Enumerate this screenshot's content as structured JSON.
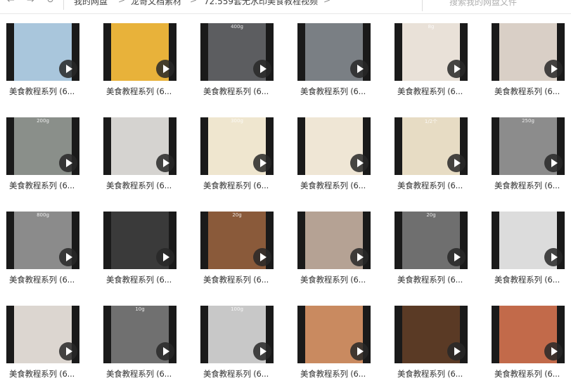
{
  "toolbar": {
    "back_icon": "back-arrow-icon",
    "forward_icon": "forward-arrow-icon",
    "refresh_icon": "refresh-icon"
  },
  "breadcrumb": {
    "items": [
      "我的网盘",
      "龙哥文档素材",
      "72.559套无水印美食教程视频"
    ]
  },
  "search": {
    "placeholder": "搜索我的网盘文件"
  },
  "files": [
    {
      "name": "美食教程系列 (6...",
      "thumb": "tofu",
      "tag": ""
    },
    {
      "name": "美食教程系列 (6...",
      "thumb": "eggs-mushroom",
      "tag": ""
    },
    {
      "name": "美食教程系列 (6...",
      "thumb": "gray-bowl",
      "tag": "400g"
    },
    {
      "name": "美食教程系列 (6...",
      "thumb": "pan",
      "tag": ""
    },
    {
      "name": "美食教程系列 (6...",
      "thumb": "sauce-dish",
      "tag": "8g"
    },
    {
      "name": "美食教程系列 (6...",
      "thumb": "red-meat",
      "tag": ""
    },
    {
      "name": "美食教程系列 (6...",
      "thumb": "seaweed-bowl",
      "tag": "200g"
    },
    {
      "name": "美食教程系列 (6...",
      "thumb": "white-plate",
      "tag": ""
    },
    {
      "name": "美食教程系列 (6...",
      "thumb": "cabbage",
      "tag": "300g"
    },
    {
      "name": "美食教程系列 (6...",
      "thumb": "garlic-bowl",
      "tag": ""
    },
    {
      "name": "美食教程系列 (6...",
      "thumb": "cabbage-half",
      "tag": "1/2个"
    },
    {
      "name": "美食教程系列 (6...",
      "thumb": "gray-surface",
      "tag": "250g"
    },
    {
      "name": "美食教程系列 (6...",
      "thumb": "meat-bowl",
      "tag": "800g"
    },
    {
      "name": "美食教程系列 (6...",
      "thumb": "rice-cooker",
      "tag": ""
    },
    {
      "name": "美食教程系列 (6...",
      "thumb": "wood-glass",
      "tag": "20g"
    },
    {
      "name": "美食教程系列 (6...",
      "thumb": "wood-glass2",
      "tag": ""
    },
    {
      "name": "美食教程系列 (6...",
      "thumb": "gray-glass",
      "tag": "20g"
    },
    {
      "name": "美食教程系列 (6...",
      "thumb": "green-onion",
      "tag": ""
    },
    {
      "name": "美食教程系列 (6...",
      "thumb": "shrimp",
      "tag": ""
    },
    {
      "name": "美食教程系列 (6...",
      "thumb": "gray-glass2",
      "tag": "10g"
    },
    {
      "name": "美食教程系列 (6...",
      "thumb": "gray-glass3",
      "tag": "100g"
    },
    {
      "name": "美食教程系列 (6...",
      "thumb": "hands-dough",
      "tag": ""
    },
    {
      "name": "美食教程系列 (6...",
      "thumb": "fried-chicken",
      "tag": ""
    },
    {
      "name": "美食教程系列 (6...",
      "thumb": "blender",
      "tag": ""
    }
  ],
  "thumb_colors": {
    "tofu": "#a9c6dc",
    "eggs-mushroom": "#e8b23a",
    "gray-bowl": "#5c5d60",
    "pan": "#7a7f84",
    "sauce-dish": "#e9e1d8",
    "red-meat": "#d9cfc6",
    "seaweed-bowl": "#8a8f8a",
    "white-plate": "#d5d3d0",
    "cabbage": "#efe6cf",
    "garlic-bowl": "#efe6d5",
    "cabbage-half": "#e7dcc4",
    "gray-surface": "#8c8c8c",
    "meat-bowl": "#8b8b8b",
    "rice-cooker": "#3a3a3a",
    "wood-glass": "#8a5a3a",
    "wood-glass2": "#b5a294",
    "gray-glass": "#6f6f6f",
    "green-onion": "#dcdcdc",
    "shrimp": "#dcd6d0",
    "gray-glass2": "#707070",
    "gray-glass3": "#c8c8c8",
    "hands-dough": "#c98a60",
    "fried-chicken": "#5a3a25",
    "blender": "#c26a4a"
  }
}
